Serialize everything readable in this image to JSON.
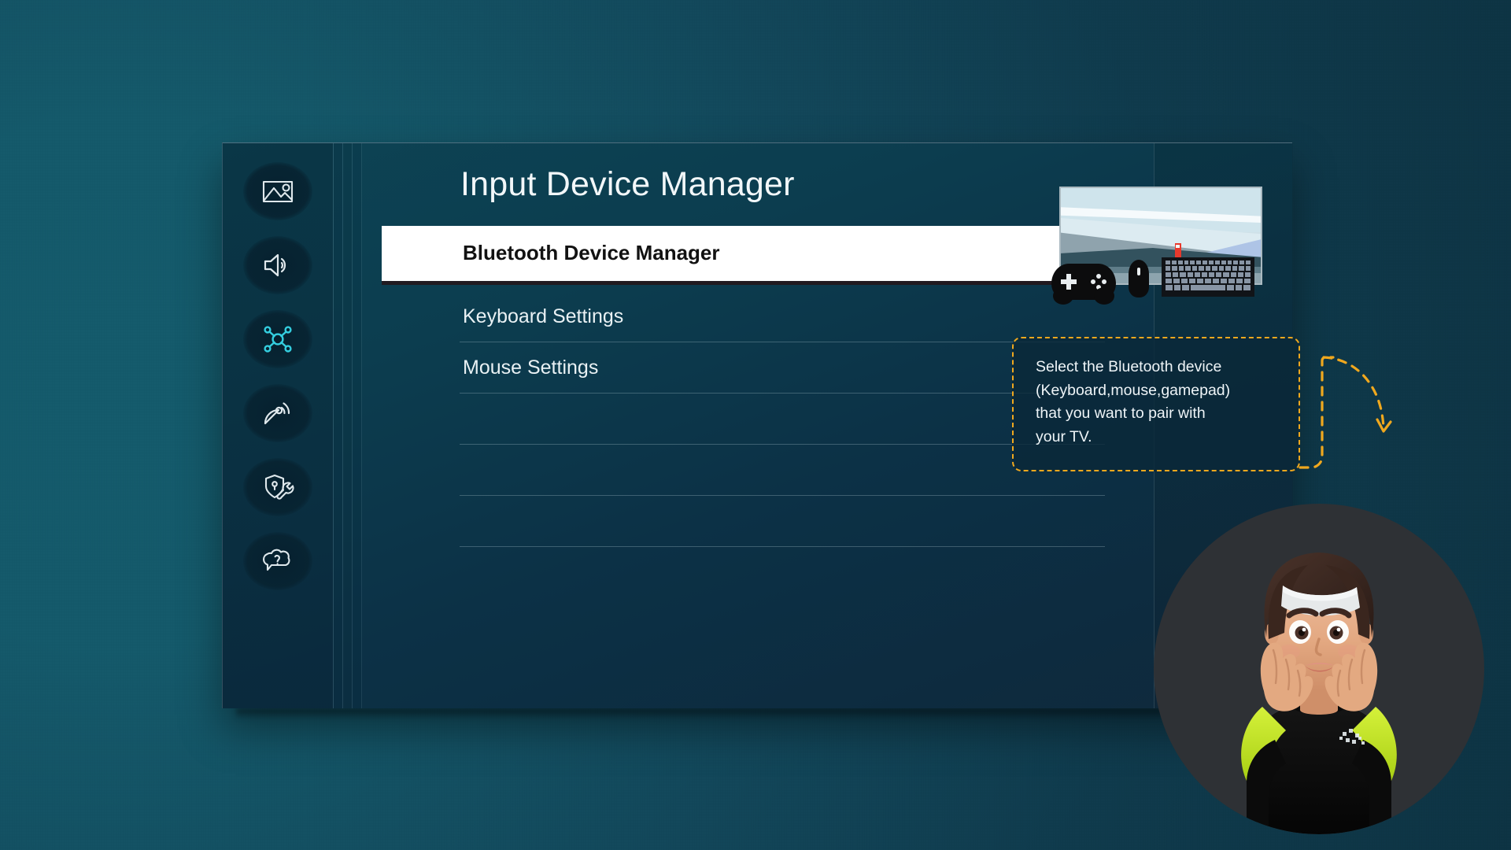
{
  "screen": {
    "background_color": "#12475a",
    "accent_color": "#2fc6d6",
    "highlight_color": "#f0a81e"
  },
  "sidebar": {
    "name": "settings-icon-rail",
    "items": [
      {
        "id": "picture",
        "icon": "picture-icon",
        "label": "Picture",
        "selected": false
      },
      {
        "id": "sound",
        "icon": "sound-icon",
        "label": "Sound",
        "selected": false
      },
      {
        "id": "connection",
        "icon": "connection-icon",
        "label": "Connection",
        "selected": true
      },
      {
        "id": "broadcast",
        "icon": "broadcast-icon",
        "label": "Broadcasting",
        "selected": false
      },
      {
        "id": "general",
        "icon": "shield-wrench-icon",
        "label": "General & Privacy",
        "selected": false
      },
      {
        "id": "support",
        "icon": "help-bubble-icon",
        "label": "Support",
        "selected": false
      }
    ]
  },
  "main": {
    "title": "Input Device Manager",
    "menu_items": [
      {
        "label": "Bluetooth Device Manager",
        "selected": true
      },
      {
        "label": "Keyboard Settings",
        "selected": false
      },
      {
        "label": "Mouse Settings",
        "selected": false
      },
      {
        "label": "",
        "selected": false
      },
      {
        "label": "",
        "selected": false
      },
      {
        "label": "",
        "selected": false
      },
      {
        "label": "",
        "selected": false
      }
    ]
  },
  "illustration": {
    "name": "tv-with-input-devices",
    "devices": [
      "gamepad",
      "mouse",
      "keyboard"
    ],
    "screen_scene": "mountain-lake-landscape"
  },
  "tooltip": {
    "text": "Select the Bluetooth device\n(Keyboard,mouse,gamepad)\nthat you want to pair with\nyour TV.",
    "border_color": "#f0a81e"
  },
  "avatar": {
    "name": "assistant-avatar",
    "description": "3D character with white headband, black and neon-green shirt, hands raised beside face"
  }
}
